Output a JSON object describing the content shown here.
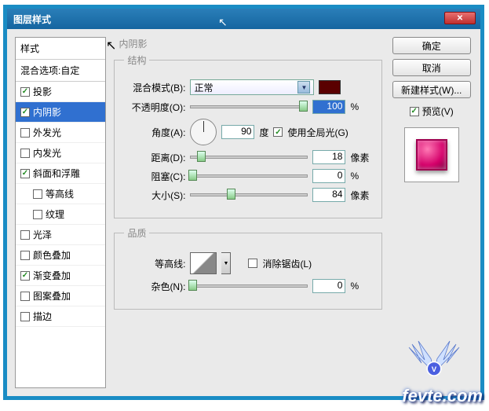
{
  "window": {
    "title": "图层样式"
  },
  "left": {
    "header": "样式",
    "blend": "混合选项:自定",
    "items": [
      {
        "label": "投影",
        "checked": true,
        "selected": false,
        "indent": false
      },
      {
        "label": "内阴影",
        "checked": true,
        "selected": true,
        "indent": false
      },
      {
        "label": "外发光",
        "checked": false,
        "selected": false,
        "indent": false
      },
      {
        "label": "内发光",
        "checked": false,
        "selected": false,
        "indent": false
      },
      {
        "label": "斜面和浮雕",
        "checked": true,
        "selected": false,
        "indent": false
      },
      {
        "label": "等高线",
        "checked": false,
        "selected": false,
        "indent": true
      },
      {
        "label": "纹理",
        "checked": false,
        "selected": false,
        "indent": true
      },
      {
        "label": "光泽",
        "checked": false,
        "selected": false,
        "indent": false
      },
      {
        "label": "颜色叠加",
        "checked": false,
        "selected": false,
        "indent": false
      },
      {
        "label": "渐变叠加",
        "checked": true,
        "selected": false,
        "indent": false
      },
      {
        "label": "图案叠加",
        "checked": false,
        "selected": false,
        "indent": false
      },
      {
        "label": "描边",
        "checked": false,
        "selected": false,
        "indent": false
      }
    ]
  },
  "mid": {
    "section_title": "内阴影",
    "structure": {
      "legend": "结构",
      "blend_label": "混合模式(B):",
      "blend_value": "正常",
      "opacity_label": "不透明度(O):",
      "opacity_value": "100",
      "opacity_unit": "%",
      "angle_label": "角度(A):",
      "angle_value": "90",
      "angle_unit": "度",
      "global_light_label": "使用全局光(G)",
      "global_light_checked": true,
      "distance_label": "距离(D):",
      "distance_value": "18",
      "distance_unit": "像素",
      "choke_label": "阻塞(C):",
      "choke_value": "0",
      "choke_unit": "%",
      "size_label": "大小(S):",
      "size_value": "84",
      "size_unit": "像素"
    },
    "quality": {
      "legend": "品质",
      "contour_label": "等高线:",
      "antialias_label": "消除锯齿(L)",
      "antialias_checked": false,
      "noise_label": "杂色(N):",
      "noise_value": "0",
      "noise_unit": "%"
    }
  },
  "right": {
    "ok": "确定",
    "cancel": "取消",
    "new_style": "新建样式(W)...",
    "preview_label": "预览(V)",
    "preview_checked": true
  },
  "watermark": "fevte.com"
}
